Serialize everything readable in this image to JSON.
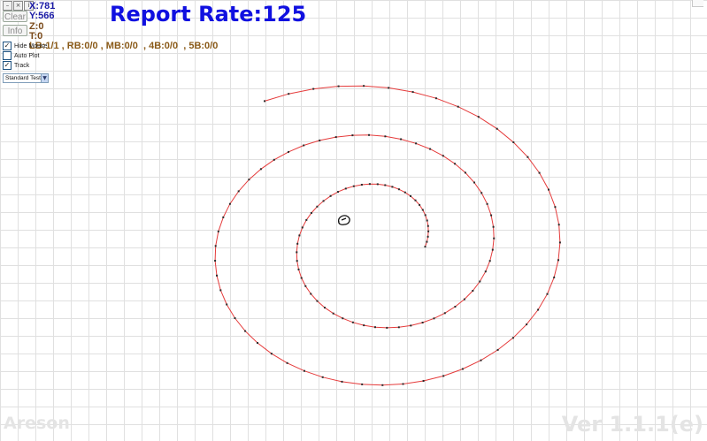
{
  "window": {
    "buttons": [
      {
        "name": "minimize-icon",
        "glyph": "–"
      },
      {
        "name": "close-icon",
        "glyph": "×"
      },
      {
        "name": "info-icon",
        "glyph": "i"
      }
    ]
  },
  "toolbar": {
    "clear_label": "Clear",
    "info_label": "Info"
  },
  "readout": {
    "x": "X:781",
    "y": "Y:566",
    "z": "Z:0",
    "t": "T:0"
  },
  "title": "Report Rate:125",
  "mouse_buttons": "LB:1/1 , RB:0/0 , MB:0/0  , 4B:0/0  , 5B:0/0",
  "options": [
    {
      "label": "Hide Mouse",
      "checked": true
    },
    {
      "label": "Auto Plot",
      "checked": false
    },
    {
      "label": "Track",
      "checked": true
    }
  ],
  "test_mode": {
    "selected": "Standard Test"
  },
  "watermark": {
    "brand": "Areson",
    "version": "Ver 1.1.1(e)"
  },
  "colors": {
    "trace": "#e53b3b",
    "sample_dot": "#2a2a2a",
    "title": "#1010e0",
    "readout_blue": "#1a1aa6",
    "readout_brown": "#7a4a1a"
  },
  "trace": {
    "description_note": "",
    "start_angle_deg": -105,
    "turns": 2.35,
    "samples": 125,
    "center": [
      418,
      266
    ],
    "growth": 0.72
  }
}
